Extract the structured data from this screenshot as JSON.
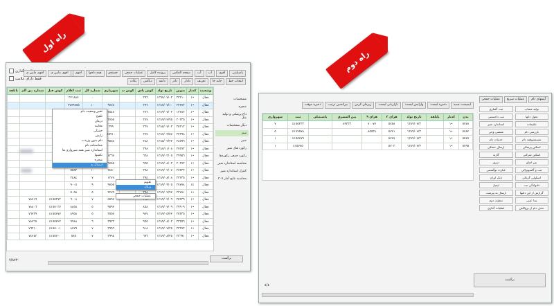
{
  "banners": {
    "first": "راه اول",
    "second": "راه دوم"
  },
  "win1": {
    "top_checks": [
      "علامت گذاری",
      "فقط دارای علامت"
    ],
    "search_label": "جستجو",
    "toolbar_row1": [
      "پاسیلیتی",
      "اقوی",
      "اب",
      "آب",
      "صفحه الفکس",
      "پرونده کامل",
      "عملیات جمعی",
      "جستجو",
      "همه دلخوا",
      "اقوی",
      "اقوی مابین ی",
      "اقوی مابین ی"
    ],
    "toolbar_row2": [
      "انتخاب خط",
      "جابه جا",
      "تعریف",
      "دادار",
      "دادر",
      "دکمه",
      "دیاکس",
      "یکات"
    ],
    "columns": [
      "وضعیت",
      "کدتار",
      "بدوین",
      "تاریخ تولد",
      "کوش پاس",
      "کوش ت",
      "شهریاری",
      "شماره کل",
      "ثبت اعلام",
      "کوش فیل",
      "شماره بین آلم",
      "بابلقه"
    ],
    "rows": [
      [
        "فعال",
        "•١",
        "٣٣٣١٠",
        "١٣٩٧/٠٧/٠٣",
        "٣٩٦",
        "",
        "",
        "٠",
        "٣٢١٨٨٧",
        "",
        "",
        ""
      ],
      [
        "فعال",
        "•١",
        "٣٢٣٧٣",
        "١٣٨٧/٠٧/١٠",
        "٣٩٦",
        "",
        "٩٧٧٨",
        "١٠",
        "٣٧٧٩٧٥٥",
        "",
        "",
        ""
      ],
      [
        "فعال",
        "•١",
        "١٣٢٨٣",
        "١٣٨٩/٠٧/٠٣",
        "٣٧٦",
        "",
        "٣٥٤٧",
        "١٠",
        "",
        "",
        "",
        ""
      ],
      [
        "فعال",
        "•١",
        "٣٠٣٣٥",
        "١٣٨٩/١٢/٩٥",
        "٣٧٧",
        "",
        "٣٧٥٥",
        "١٠",
        "٤٥٥٥٧٧٢",
        "",
        "",
        ""
      ],
      [
        "فعال",
        "•١",
        "٣٥٣١٣",
        "١٣٨٥/٠٧/٠٣",
        "٣٦٧",
        "",
        "٣٩٩",
        "١٠",
        "٤٥٥٥٩٠٩",
        "",
        "",
        ""
      ],
      [
        "فعال",
        "•١",
        "٣٢٣٩٨",
        "١٣٨٧/٠٣/٥٧",
        "٣٧٧",
        "",
        "٥٥٩١٠",
        "٦",
        "٤٣٧٥٥",
        "",
        "",
        ""
      ],
      [
        "فعال",
        "•١",
        "٣٨٥٩٦",
        "١٣٨٥/٠٣/٢٣",
        "٣٨٨",
        "",
        "٩٥٥٨",
        "٩",
        "١٤٨٠",
        "",
        "",
        ""
      ],
      [
        "فعال",
        "•١",
        "٣٧٣٧٣",
        "١٣٨٧/١١/٠٨",
        "٣٩٨",
        "",
        "",
        "٩",
        "٥٥٦",
        "",
        "",
        ""
      ],
      [
        "فعال",
        "•١",
        "٣٩٩٥٦",
        "١٣٨٩/٠٣/٠٥",
        "٦٦٨",
        "",
        "١٣٦٧",
        "٩",
        "٥٨٧٣",
        "",
        "",
        ""
      ],
      [
        "فعال",
        "•١",
        "٣٠٣٧٣",
        "١٣٨٩/٠٨/٠٣",
        "٩٦٥",
        "",
        "٩٧٥٥",
        "٩",
        "٥٨٠",
        "",
        "",
        ""
      ],
      [
        "فعال",
        "•١",
        "٣٧٣٣٣",
        "١٣٨٩/٠٢/٠٧",
        "٣٩٨",
        "",
        "٣٤٥٠",
        "١٠",
        "٥٥٥٣",
        "",
        "",
        ""
      ],
      [
        "فعال",
        "•١",
        "٣٣٣٣٥",
        "١٣٨٩/٠٨/٠٨",
        "٣٩٤",
        "",
        "١٣٧٧",
        "٧",
        "٣٤٨٤",
        "",
        "",
        ""
      ],
      [
        "فعال",
        "١٤",
        "٣٧٧٧٨",
        "١٣٨٩/٠٩/٠٥",
        "٣٨٨",
        "",
        "٩٧٥٥",
        "٩",
        "٩٠٠٥",
        "",
        "",
        ""
      ],
      [
        "فعال",
        "•١",
        "٣٣٧٧١",
        "١٣٨٩/٠٢/٩٢",
        "٣٩٨",
        "",
        "٣٢٧٩",
        "٥",
        "٥٠٥٨",
        "",
        "",
        ""
      ],
      [
        "فعال",
        "•١",
        "٣٥٣٣٩",
        "١٣٨٩/٠٢/٠٩",
        "٣٩٨",
        "",
        "٥٥٩٧",
        "٧",
        "٦٠٠٨",
        "٤١٥٥٣٧٣",
        "٧٨٧١٩",
        ""
      ],
      [
        "فعال",
        "•١",
        "٣٩٩٠٩",
        "١٣٨٩/٠٧/٠٩",
        "٨٥٨",
        "",
        "٩٥٩٢",
        "٥",
        "٨٨٥٨",
        "٤١٥٥٠٣٧",
        "٧٨٨٠٦",
        ""
      ],
      [
        "فعال",
        "•١",
        "٣٥٣٣٥",
        "١٣٨٩/٠٥/٢٢",
        "٩٧٧",
        "",
        "٣٥٥٧",
        "٥",
        "٨٩٥٨",
        "٤١٥٥٧٧٧",
        "٧٦٧٣٩",
        ""
      ],
      [
        "فعال",
        "•١",
        "٣٣٣٥٦",
        "١٣٨٩/٠٨/٠٣",
        "٩٦٥",
        "",
        "٣٩٣٣",
        "٦",
        "٩٩٨٨",
        "٤١٥٥٢٢٢",
        "٧٨٧٦٧",
        ""
      ],
      [
        "فعال",
        "•١",
        "٣٣٣٧٣",
        "١٣٨٩/٠٧/٣٥",
        "٩١٨",
        "",
        "٣٩٩٦",
        "٧",
        "٨٧٢٩",
        "٤١٥٥٠٠١",
        "٧٦٣١٠",
        ""
      ],
      [
        "فعال",
        "•١",
        "٣٣٦٩١",
        "١٣٨٩/٠٨/٢٥",
        "٦٩٦",
        "",
        "٣٩٩٤",
        "٧",
        "٥٨٥",
        "٤١٥٥٧٠٠",
        "٧٤٧٤٣",
        ""
      ]
    ],
    "side_items": [
      "مشخصات",
      "شجره",
      "داغ پزشکی و تولید مثل",
      "دیگر مشخصات",
      "سم",
      "شیر",
      "رکورد های شیر",
      "رکورد جمعی رکوردها",
      "محاسبه استاندارد شیر",
      "کنترل استاندارد شیر",
      "محاسبه نتایج آمار ٣٠٥"
    ],
    "context_menu": [
      "تغییر وضعیت دام",
      "تلقیح",
      "درمان",
      "معاینه",
      "خشکی",
      "زایش",
      "دام بدون وزیدت",
      "شناسنامه دام",
      "استاندارد شیر همه شیرواری ها",
      "نکسها",
      "شجره",
      "ارسال به"
    ],
    "submenu": [
      "تقویم",
      "پرتال"
    ],
    "submenu2": "عملیات جمعی",
    "return_button": "برگشت",
    "status_count": "٧/٨٧٣٠"
  },
  "win2": {
    "tabs": [
      "آیتمهای دام",
      "عملیات سریع",
      "عملیات جمعی"
    ],
    "toolbar": [
      "ایمیشت جدید",
      "ذخیره لیست",
      "وارایش لیست",
      "بازاریابی لیست",
      "زیرمان کردن",
      "بیرانشین ترتیب",
      "ذخیره موقت"
    ],
    "columns": [
      "بدن",
      "کدتار",
      "بابلقه",
      "تاریخ تولد",
      "هزای ٢",
      "هزای ٩",
      "بین المشرق",
      "پاشیتیلی",
      "ثبت",
      "شهرواری"
    ],
    "rows": [
      [
        "٥٧٧٨",
        "•١",
        "",
        "١٣٨٩/٠٧/٣",
        "٥٧٥٨",
        "٧٠٠٧٧",
        "٨٩٣٣٣",
        "",
        "٤١٥٥٣٣٣",
        "٧"
      ],
      [
        "٥٧٨٢",
        "•١",
        "",
        "١٣٨٩/٠٧/٣",
        "٥٧٧١",
        "٨٥٥٣٨",
        "",
        "",
        "٤١٧٧٥٧٨",
        "٥"
      ],
      [
        "٥٥٧٧",
        "•١",
        "",
        "١٣٨٩/٠٧/٣",
        "٥٧٧٧",
        "",
        "",
        "",
        "٤١٥٥٧٧٩",
        "١"
      ],
      [
        "٥٧٩٥",
        "•١",
        "",
        "١٣٨٩/٠٧/٢",
        "٥٧٠٣",
        "",
        "",
        "",
        "٤١٥٧٧٥",
        "١"
      ]
    ],
    "buttons": [
      "تولید مشاب",
      "ثبت گفتاری",
      "نحول ذانها",
      "ثبت ذاجستنی",
      "تلقیحات",
      "استاندارد شیر",
      "بازرسی دام",
      "شتصی وجی",
      "شستشوفعه دام",
      "خدمات دام",
      "اسکین پزشکی",
      "ارسال خشکی",
      "اسکین شرکتی",
      "گازیه",
      "بین امیلو",
      "دیروز",
      "ثبت و آکسونرالی",
      "عبارت نوگشتنی",
      "اسکولی گزیالن",
      "بانک ایران",
      "خانوادگی ثبت",
      "ایمیل",
      "گزارش از این دامها",
      "ارسال به پیرمنت",
      "پیدا عینی",
      "تنظیف دوم",
      "حذف دام از بروکاش",
      "عملیات گذاری"
    ],
    "return_button": "برگشت",
    "status_count": "٤/٤"
  }
}
